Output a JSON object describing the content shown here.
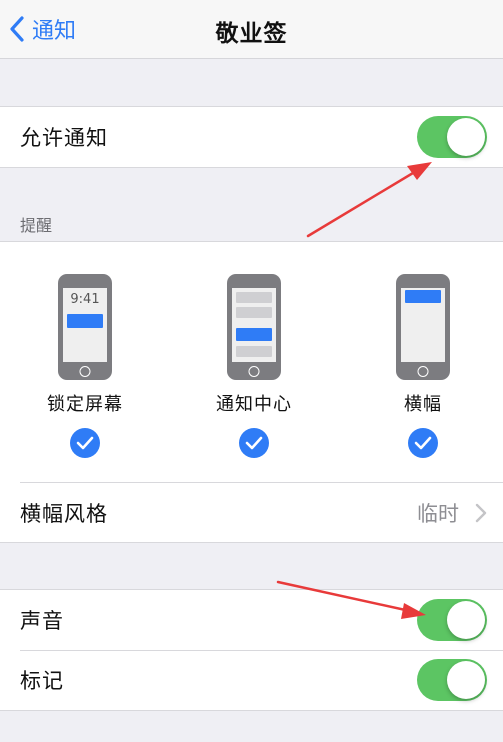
{
  "nav": {
    "back_label": "通知",
    "title": "敬业签"
  },
  "allow": {
    "label": "允许通知",
    "on": true
  },
  "alerts": {
    "header": "提醒",
    "lock": {
      "time": "9:41",
      "label": "锁定屏幕",
      "checked": true
    },
    "center": {
      "label": "通知中心",
      "checked": true
    },
    "banner": {
      "label": "横幅",
      "checked": true
    }
  },
  "banner_style": {
    "label": "横幅风格",
    "value": "临时"
  },
  "sound": {
    "label": "声音",
    "on": true
  },
  "badge": {
    "label": "标记",
    "on": true
  },
  "colors": {
    "accent": "#2f7cf6",
    "toggle_on": "#5cc563",
    "annotation": "#e83a3a"
  }
}
